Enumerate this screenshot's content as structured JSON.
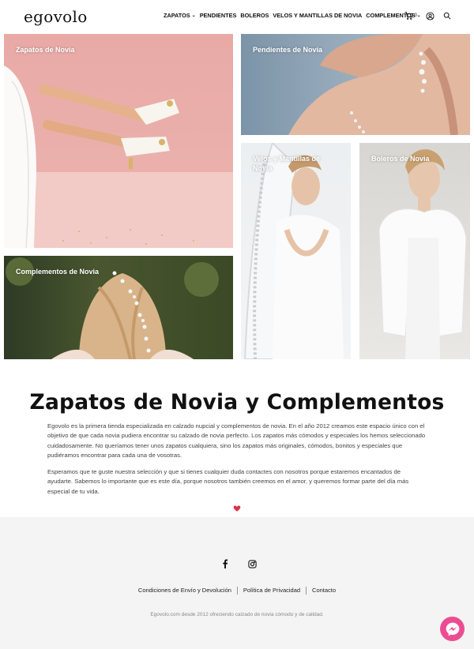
{
  "header": {
    "logo": "egovolo",
    "nav": [
      {
        "label": "ZAPATOS",
        "has_dropdown": true
      },
      {
        "label": "PENDIENTES",
        "has_dropdown": false
      },
      {
        "label": "BOLEROS",
        "has_dropdown": false
      },
      {
        "label": "VELOS Y MANTILLAS DE NOVIA",
        "has_dropdown": false
      },
      {
        "label": "COMPLEMENTOS",
        "has_dropdown": true
      }
    ],
    "cart_count": "0",
    "icons": [
      "cart-icon",
      "user-icon",
      "search-icon"
    ]
  },
  "categories": {
    "zapatos": "Zapatos de Novia",
    "pendientes": "Pendientes de Novia",
    "velos": "Velos y Mantillas de Novia",
    "boleros": "Boleros de Novia",
    "complementos": "Complementos de Novia"
  },
  "main": {
    "title": "Zapatos de Novia y Complementos",
    "paragraph1": "Egovolo es la primera tienda especializada en calzado nupcial y complementos de novia. En el año 2012 creamos este espacio único con el objetivo de que cada novia pudiera encontrar su calzado de novia perfecto. Los zapatos más cómodos y especiales los hemos seleccionado cuidadosamente. No queríamos tener unos zapatos cualquiera, sino los zapatos más originales, cómodos, bonitos y especiales que pudiéramos encontrar para cada una de vosotras.",
    "paragraph2": "Esperamos que te guste nuestra selección y que si tienes cualquier duda contactes con nosotros porque estaremos encantados de ayudarte. Sabemos lo importante que es este día, porque nosotros también creemos en el amor, y queremos formar parte del día más especial de tu vida."
  },
  "footer": {
    "social": [
      "facebook-icon",
      "instagram-icon"
    ],
    "links": {
      "conditions": "Condiciones de Envío y Devolución",
      "privacy": "Política de Privacidad",
      "contact": "Contacto"
    },
    "copyright": "Egovolo.com desde 2012 ofreciendo calzado de novia cómodo y de calidad."
  },
  "colors": {
    "accent_heart": "#d8334a",
    "chat_button": "#ec4d92",
    "footer_bg": "#f4f4f4"
  }
}
